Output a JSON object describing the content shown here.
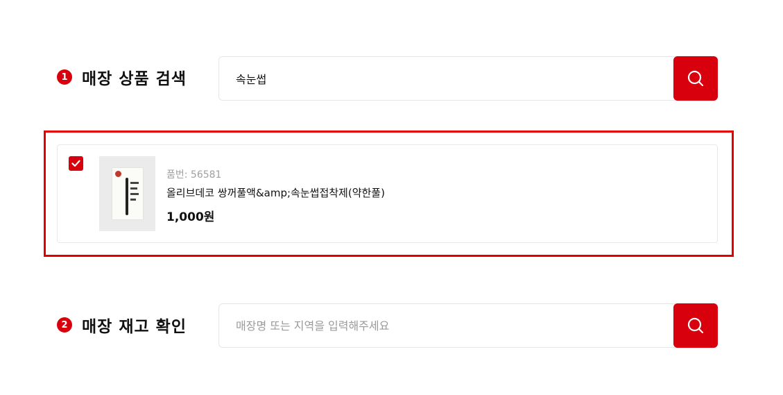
{
  "step1": {
    "number": "1",
    "title": "매장 상품 검색",
    "search_value": "속눈썹"
  },
  "product": {
    "checked": true,
    "code": "품번: 56581",
    "name": "올리브데코 쌍꺼풀액&amp;속눈썹접착제(약한풀)",
    "price": "1,000원"
  },
  "step2": {
    "number": "2",
    "title": "매장 재고 확인",
    "search_placeholder": "매장명 또는 지역을 입력해주세요"
  },
  "colors": {
    "accent": "#d9000d",
    "highlight": "#e50000"
  },
  "icons": {
    "search": "search-icon",
    "check": "check-icon"
  }
}
